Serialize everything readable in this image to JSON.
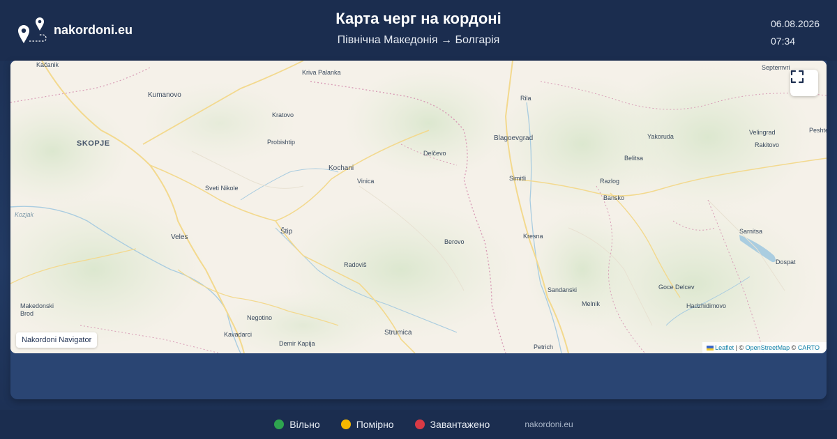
{
  "header": {
    "brand_name": "nakordoni.eu",
    "title": "Карта черг на кордоні",
    "subtitle": "Північна Македонія → Болгарія",
    "date": "06.08.2026",
    "time": "07:34"
  },
  "map": {
    "fullscreen_icon": "fullscreen-icon",
    "nav_badge": "Nakordoni Navigator",
    "attribution": {
      "leaflet": "Leaflet",
      "separator1": " | © ",
      "osm": "OpenStreetMap",
      "separator2": " © ",
      "carto": "CARTO"
    },
    "labels": [
      "Kačanik",
      "Kriva Palanka",
      "Septemvri",
      "Kumanovo",
      "Rila",
      "Kratovo",
      "Blagoevgrad",
      "Yakoruda",
      "Velingrad",
      "Peshtera",
      "SKOPJE",
      "Probishtip",
      "Delčevo",
      "Rakitovo",
      "Belitsa",
      "Kochani",
      "Simitli",
      "Vinica",
      "Razlog",
      "Sveti Nikole",
      "Bansko",
      "Kozjak",
      "Štip",
      "Sarnitsa",
      "Veles",
      "Kresna",
      "Berovo",
      "Radoviš",
      "Dospat",
      "Sandanski",
      "Goce Delcev",
      "Melnik",
      "Hadzhidimovo",
      "Makedonski Brod",
      "Negotino",
      "Strumica",
      "Kavadarci",
      "Demir Kapija",
      "Petrich"
    ]
  },
  "legend": [
    {
      "label": "Вільно",
      "color": "#2ea44f"
    },
    {
      "label": "Помірно",
      "color": "#f5b800"
    },
    {
      "label": "Завантажено",
      "color": "#d93a45"
    }
  ],
  "footer": {
    "site": "nakordoni.eu"
  }
}
